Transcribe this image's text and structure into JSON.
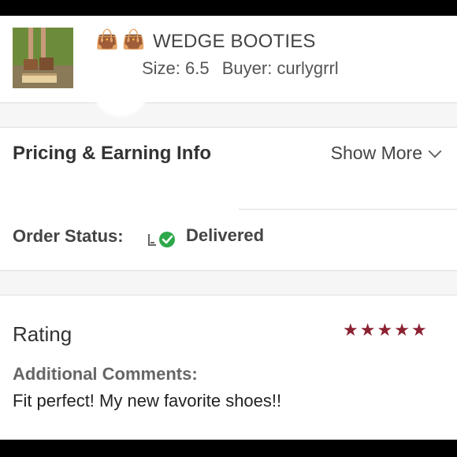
{
  "listing": {
    "emoji_1": "👜",
    "emoji_2": "👜",
    "title": "WEDGE BOOTIES",
    "size_text": "Size: 6.5",
    "buyer_text": "Buyer: curlygrrl"
  },
  "pricing": {
    "title": "Pricing & Earning Info",
    "show_more_label": "Show More"
  },
  "order": {
    "label": "Order Status:",
    "value": "Delivered",
    "status_color": "#2ea84a"
  },
  "rating": {
    "title": "Rating",
    "stars": 5,
    "star_color": "#8b2131",
    "comments_label": "Additional Comments:",
    "comments_text": "Fit perfect! My new favorite shoes!!"
  },
  "icons": {
    "thumbnail": "boots-photo",
    "chevron": "chevron-down-icon",
    "status": "delivered-check-icon",
    "star": "star-icon"
  }
}
